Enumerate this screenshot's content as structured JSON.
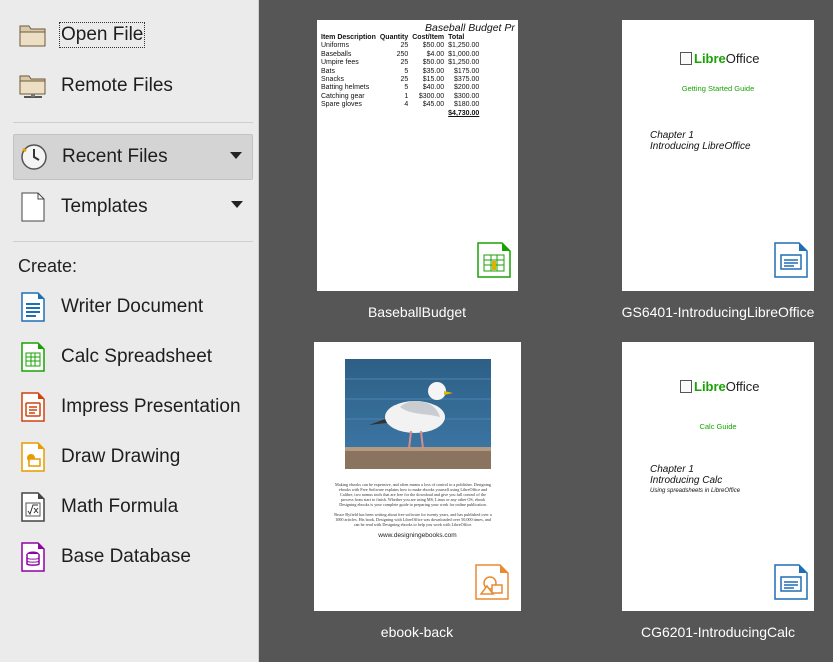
{
  "sidebar": {
    "open_file": "Open File",
    "remote_files": "Remote Files",
    "recent_files": "Recent Files",
    "templates": "Templates",
    "create_label": "Create:",
    "writer": "Writer Document",
    "calc": "Calc Spreadsheet",
    "impress": "Impress Presentation",
    "draw": "Draw Drawing",
    "math": "Math Formula",
    "base": "Base Database"
  },
  "recent": [
    {
      "name": "BaseballBudget",
      "kind": "calc"
    },
    {
      "name": "GS6401-IntroducingLibreOffice",
      "kind": "writer"
    },
    {
      "name": "ebook-back",
      "kind": "draw"
    },
    {
      "name": "CG6201-IntroducingCalc",
      "kind": "writer"
    }
  ],
  "baseball": {
    "title": "Baseball Budget Pr",
    "headers": [
      "Item Description",
      "Quantity",
      "Cost/Item",
      "Total"
    ],
    "rows": [
      [
        "Uniforms",
        "25",
        "$50.00",
        "$1,250.00"
      ],
      [
        "Baseballs",
        "250",
        "$4.00",
        "$1,000.00"
      ],
      [
        "Umpire fees",
        "25",
        "$50.00",
        "$1,250.00"
      ],
      [
        "Bats",
        "5",
        "$35.00",
        "$175.00"
      ],
      [
        "Snacks",
        "25",
        "$15.00",
        "$375.00"
      ],
      [
        "Batting helmets",
        "5",
        "$40.00",
        "$200.00"
      ],
      [
        "Catching gear",
        "1",
        "$300.00",
        "$300.00"
      ],
      [
        "Spare gloves",
        "4",
        "$45.00",
        "$180.00"
      ]
    ],
    "total": "$4,730.00"
  },
  "gs_doc": {
    "logo_libre": "Libre",
    "logo_office": "Office",
    "guide": "Getting Started Guide",
    "chapter": "Chapter 1",
    "chapter_title": "Introducing LibreOffice"
  },
  "cg_doc": {
    "logo_libre": "Libre",
    "logo_office": "Office",
    "guide": "Calc Guide",
    "chapter": "Chapter 1",
    "chapter_title": "Introducing Calc",
    "subtitle": "Using spreadsheets in LibreOffice"
  },
  "ebook": {
    "para1": "Making ebooks can be expensive, and often means a loss of control to a publisher. Designing ebooks with Free Software explains how to make ebooks yourself using LibreOffice and Calibre, two nomus tools that are free for the download and give you full control of the process from start to finish. Whether you are using MS, Linux or any other OS, ebook Designing ebooks is your complete guide to preparing your work for online publication.",
    "para2": "Bruce Byfield has been writing about free software for twenty years, and has published over a 1000 articles. His book, Designing with LibreOffice was downloaded over 50,000 times, and can be read with Designing ebooks to help you work with LibreOffice.",
    "url": "www.designingebooks.com"
  },
  "colors": {
    "sidebar_bg": "#ebebeb",
    "main_bg": "#565656",
    "writer_blue": "#1f6fb5",
    "calc_green": "#18a303",
    "impress_orange": "#d0430f",
    "draw_yellow": "#e89c00",
    "base_purple": "#8e03a3"
  }
}
